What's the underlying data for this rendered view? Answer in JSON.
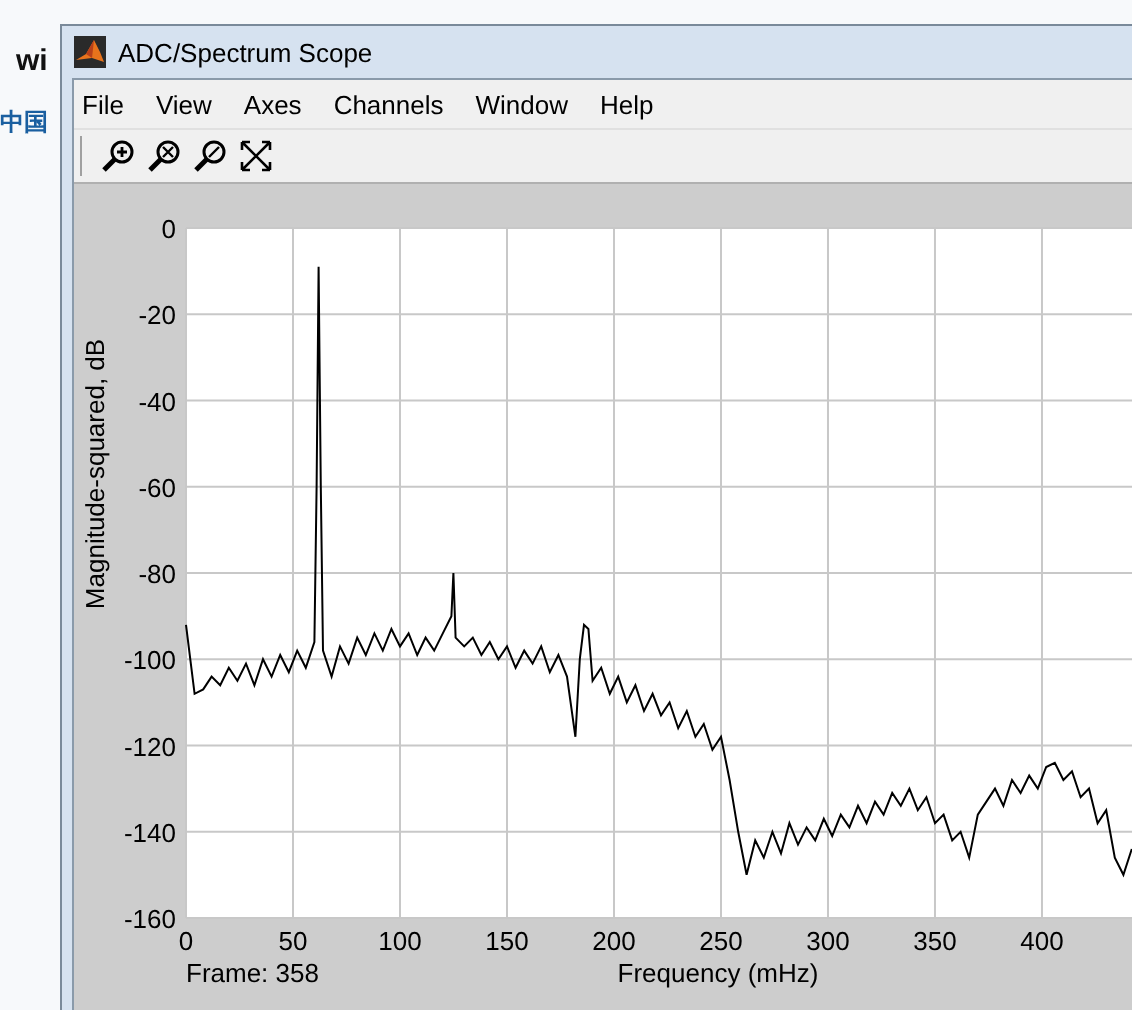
{
  "background": {
    "texts": [
      "wi",
      "中国"
    ]
  },
  "window": {
    "title": "ADC/Spectrum Scope"
  },
  "menu": [
    "File",
    "View",
    "Axes",
    "Channels",
    "Window",
    "Help"
  ],
  "toolbar": [
    {
      "kind": "zoom-in"
    },
    {
      "kind": "zoom-x"
    },
    {
      "kind": "zoom-y"
    },
    {
      "kind": "autoscale"
    }
  ],
  "plot": {
    "frame": "Frame: 358",
    "chart_data": {
      "type": "line",
      "grid": true,
      "xlabel": "Frequency (mHz)",
      "ylabel": "Magnitude-squared, dB",
      "xlim": [
        0,
        443
      ],
      "ylim": [
        -160,
        0
      ],
      "xticks": [
        0,
        50,
        100,
        150,
        200,
        250,
        300,
        350,
        400
      ],
      "yticks": [
        0,
        -20,
        -40,
        -60,
        -80,
        -100,
        -120,
        -140,
        -160
      ],
      "x": [
        0,
        4,
        8,
        12,
        16,
        20,
        24,
        28,
        32,
        36,
        40,
        44,
        48,
        52,
        56,
        60,
        61,
        62,
        63,
        64,
        68,
        72,
        76,
        80,
        84,
        88,
        92,
        96,
        100,
        104,
        108,
        112,
        116,
        120,
        124,
        125,
        126,
        130,
        134,
        138,
        142,
        146,
        150,
        154,
        158,
        162,
        166,
        170,
        174,
        178,
        182,
        184,
        186,
        188,
        190,
        194,
        198,
        202,
        206,
        210,
        214,
        218,
        222,
        226,
        230,
        234,
        238,
        242,
        246,
        250,
        254,
        258,
        262,
        266,
        270,
        274,
        278,
        282,
        286,
        290,
        294,
        298,
        302,
        306,
        310,
        314,
        318,
        322,
        326,
        330,
        334,
        338,
        342,
        346,
        350,
        354,
        358,
        362,
        366,
        370,
        374,
        378,
        382,
        386,
        390,
        394,
        398,
        402,
        406,
        410,
        414,
        418,
        422,
        426,
        430,
        434,
        438,
        442
      ],
      "values": [
        -92,
        -108,
        -107,
        -104,
        -106,
        -102,
        -105,
        -101,
        -106,
        -100,
        -104,
        -99,
        -103,
        -98,
        -102,
        -96,
        -60,
        -9,
        -60,
        -98,
        -104,
        -97,
        -101,
        -95,
        -99,
        -94,
        -98,
        -93,
        -97,
        -94,
        -99,
        -95,
        -98,
        -94,
        -90,
        -80,
        -95,
        -97,
        -95,
        -99,
        -96,
        -100,
        -97,
        -102,
        -98,
        -101,
        -97,
        -103,
        -99,
        -104,
        -118,
        -100,
        -92,
        -93,
        -105,
        -102,
        -108,
        -104,
        -110,
        -106,
        -112,
        -108,
        -113,
        -110,
        -116,
        -112,
        -118,
        -115,
        -121,
        -118,
        -128,
        -140,
        -150,
        -142,
        -146,
        -140,
        -145,
        -138,
        -143,
        -139,
        -142,
        -137,
        -141,
        -136,
        -139,
        -134,
        -138,
        -133,
        -136,
        -131,
        -134,
        -130,
        -135,
        -132,
        -138,
        -136,
        -142,
        -140,
        -146,
        -136,
        -133,
        -130,
        -134,
        -128,
        -131,
        -127,
        -130,
        -125,
        -124,
        -128,
        -126,
        -132,
        -130,
        -138,
        -135,
        -146,
        -150,
        -144
      ]
    }
  }
}
